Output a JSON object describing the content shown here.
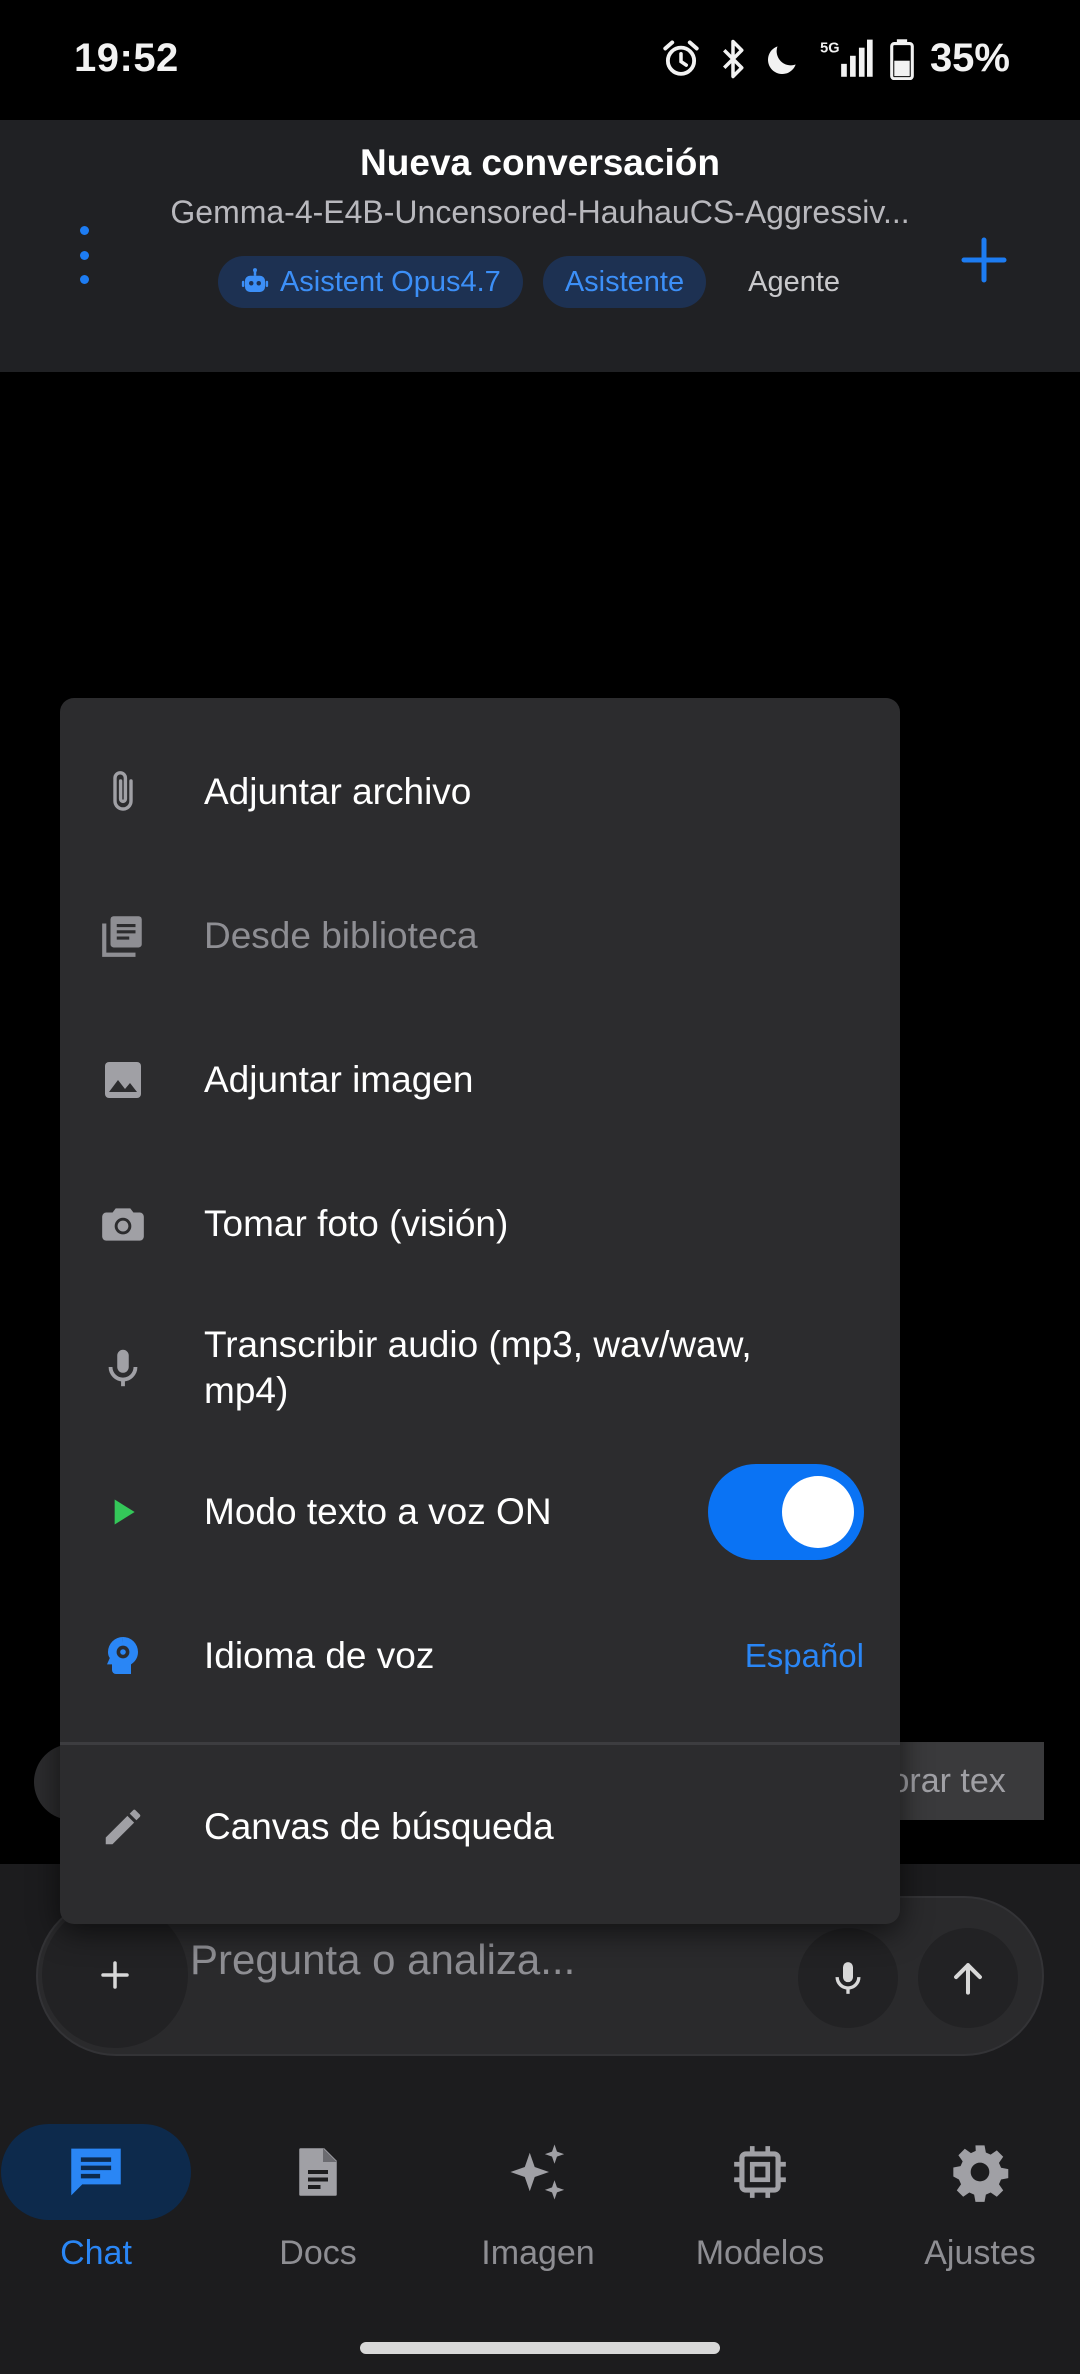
{
  "status_bar": {
    "time": "19:52",
    "battery": "35%",
    "icons": [
      "alarm-icon",
      "bluetooth-icon",
      "do-not-disturb-icon",
      "5g-signal-icon",
      "battery-icon"
    ]
  },
  "header": {
    "title": "Nueva conversación",
    "subtitle": "Gemma-4-E4B-Uncensored-HauhauCS-Aggressiv...",
    "chips": [
      {
        "label": "Asistent Opus4.7",
        "icon": "robot-icon"
      },
      {
        "label": "Asistente"
      },
      {
        "label": "Agente"
      }
    ]
  },
  "background": {
    "improve_text_fragment": "ejorar tex"
  },
  "popup_menu": {
    "items": [
      {
        "label": "Adjuntar archivo",
        "icon": "paperclip-icon"
      },
      {
        "label": "Desde biblioteca",
        "icon": "library-icon",
        "disabled": true
      },
      {
        "label": "Adjuntar imagen",
        "icon": "image-icon"
      },
      {
        "label": "Tomar foto (visión)",
        "icon": "camera-icon"
      },
      {
        "label": "Transcribir audio (mp3, wav/waw, mp4)",
        "icon": "microphone-icon"
      },
      {
        "label": "Modo texto a voz ON",
        "icon": "play-icon",
        "toggle_on": true
      },
      {
        "label": "Idioma de voz",
        "icon": "voice-settings-icon",
        "value": "Español"
      },
      {
        "label": "Canvas de búsqueda",
        "icon": "pencil-icon"
      }
    ]
  },
  "input": {
    "placeholder": "Pregunta o analiza..."
  },
  "bottom_nav": {
    "items": [
      {
        "label": "Chat",
        "icon": "chat-icon",
        "active": true
      },
      {
        "label": "Docs",
        "icon": "document-icon"
      },
      {
        "label": "Imagen",
        "icon": "sparkles-icon"
      },
      {
        "label": "Modelos",
        "icon": "chip-icon"
      },
      {
        "label": "Ajustes",
        "icon": "gear-icon"
      }
    ]
  },
  "colors": {
    "accent": "#1d7cf2",
    "toggle_on": "#0a73f4",
    "play_green": "#34c759",
    "menu_bg": "#2c2c2e"
  }
}
